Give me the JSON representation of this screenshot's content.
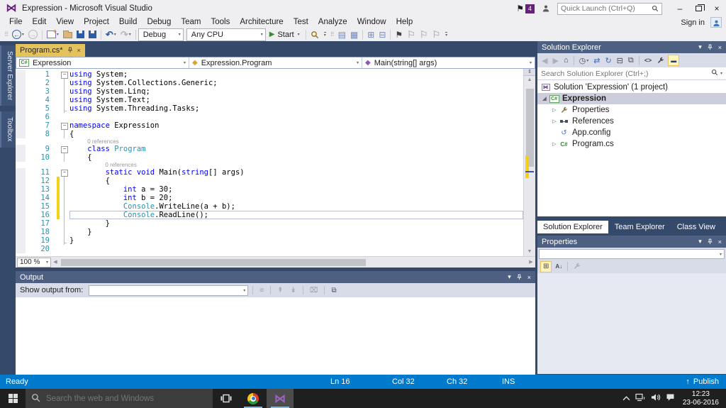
{
  "window": {
    "title": "Expression - Microsoft Visual Studio",
    "notification_count": "4",
    "quick_launch_placeholder": "Quick Launch (Ctrl+Q)",
    "sign_in": "Sign in",
    "minimize": "–",
    "close": "×"
  },
  "menu": {
    "items": [
      "File",
      "Edit",
      "View",
      "Project",
      "Build",
      "Debug",
      "Team",
      "Tools",
      "Architecture",
      "Test",
      "Analyze",
      "Window",
      "Help"
    ]
  },
  "toolbar": {
    "debug_config": "Debug",
    "platform": "Any CPU",
    "start_label": "Start"
  },
  "side_tabs": [
    "Server Explorer",
    "Toolbox"
  ],
  "editor": {
    "tab_title": "Program.cs*",
    "breadcrumbs": {
      "project": "Expression",
      "type": "Expression.Program",
      "member": "Main(string[] args)"
    },
    "zoom": "100 %",
    "codelens_label": "0 references",
    "lines": [
      {
        "n": "1",
        "o": "box",
        "s": [
          [
            "kw",
            "using"
          ],
          [
            "pl",
            " System;"
          ]
        ]
      },
      {
        "n": "2",
        "o": "line",
        "s": [
          [
            "kw",
            "using"
          ],
          [
            "pl",
            " System.Collections.Generic;"
          ]
        ]
      },
      {
        "n": "3",
        "o": "line",
        "s": [
          [
            "kw",
            "using"
          ],
          [
            "pl",
            " System.Linq;"
          ]
        ]
      },
      {
        "n": "4",
        "o": "line",
        "s": [
          [
            "kw",
            "using"
          ],
          [
            "pl",
            " System.Text;"
          ]
        ]
      },
      {
        "n": "5",
        "o": "end",
        "s": [
          [
            "kw",
            "using"
          ],
          [
            "pl",
            " System.Threading.Tasks;"
          ]
        ]
      },
      {
        "n": "6",
        "o": "none",
        "s": []
      },
      {
        "n": "7",
        "o": "box",
        "s": [
          [
            "kw",
            "namespace"
          ],
          [
            "pl",
            " Expression"
          ]
        ]
      },
      {
        "n": "8",
        "o": "line",
        "s": [
          [
            "pl",
            "{"
          ]
        ]
      },
      {
        "cl": true,
        "ind": 4
      },
      {
        "n": "9",
        "o": "box",
        "s": [
          [
            "pl",
            "    "
          ],
          [
            "kw",
            "class"
          ],
          [
            "pl",
            " "
          ],
          [
            "ty",
            "Program"
          ]
        ]
      },
      {
        "n": "10",
        "o": "line",
        "s": [
          [
            "pl",
            "    {"
          ]
        ]
      },
      {
        "cl": true,
        "ind": 8
      },
      {
        "n": "11",
        "o": "box",
        "s": [
          [
            "pl",
            "        "
          ],
          [
            "kw",
            "static"
          ],
          [
            "pl",
            " "
          ],
          [
            "kw",
            "void"
          ],
          [
            "pl",
            " Main("
          ],
          [
            "kw",
            "string"
          ],
          [
            "pl",
            "[] args)"
          ]
        ]
      },
      {
        "n": "12",
        "o": "line",
        "chg": true,
        "s": [
          [
            "pl",
            "        {"
          ]
        ]
      },
      {
        "n": "13",
        "o": "line",
        "chg": true,
        "s": [
          [
            "pl",
            "            "
          ],
          [
            "kw",
            "int"
          ],
          [
            "pl",
            " a = 30;"
          ]
        ]
      },
      {
        "n": "14",
        "o": "line",
        "chg": true,
        "s": [
          [
            "pl",
            "            "
          ],
          [
            "kw",
            "int"
          ],
          [
            "pl",
            " b = 20;"
          ]
        ]
      },
      {
        "n": "15",
        "o": "line",
        "chg": true,
        "s": [
          [
            "pl",
            "            "
          ],
          [
            "ty",
            "Console"
          ],
          [
            "pl",
            ".WriteLine(a + b);"
          ]
        ]
      },
      {
        "n": "16",
        "o": "line",
        "chg": true,
        "cur": true,
        "s": [
          [
            "pl",
            "            "
          ],
          [
            "ty",
            "Console"
          ],
          [
            "pl",
            ".ReadLine();"
          ]
        ]
      },
      {
        "n": "17",
        "o": "line",
        "s": [
          [
            "pl",
            "        }"
          ]
        ]
      },
      {
        "n": "18",
        "o": "line",
        "s": [
          [
            "pl",
            "    }"
          ]
        ]
      },
      {
        "n": "19",
        "o": "end",
        "s": [
          [
            "pl",
            "}"
          ]
        ]
      },
      {
        "n": "20",
        "o": "none",
        "s": []
      }
    ]
  },
  "output": {
    "title": "Output",
    "show_output_from_label": "Show output from:"
  },
  "solution_explorer": {
    "title": "Solution Explorer",
    "search_placeholder": "Search Solution Explorer (Ctrl+;)",
    "tree": [
      {
        "label": "Solution 'Expression' (1 project)",
        "icon": "solution",
        "exp": "hidden",
        "indent": 0
      },
      {
        "label": "Expression",
        "icon": "csharp-project",
        "exp": "expanded",
        "indent": 0,
        "selected": true,
        "bold": true
      },
      {
        "label": "Properties",
        "icon": "wrench",
        "exp": "collapsed",
        "indent": 1
      },
      {
        "label": "References",
        "icon": "references",
        "exp": "collapsed",
        "indent": 1
      },
      {
        "label": "App.config",
        "icon": "config",
        "exp": "blank",
        "indent": 1
      },
      {
        "label": "Program.cs",
        "icon": "csharp-file",
        "exp": "collapsed",
        "indent": 1
      }
    ]
  },
  "panel_tabs": [
    "Solution Explorer",
    "Team Explorer",
    "Class View"
  ],
  "properties": {
    "title": "Properties"
  },
  "status_bar": {
    "state": "Ready",
    "line": "Ln 16",
    "column": "Col 32",
    "character": "Ch 32",
    "mode": "INS",
    "publish": "Publish"
  },
  "taskbar": {
    "search_placeholder": "Search the web and Windows",
    "time": "12:23",
    "date": "23-06-2016"
  },
  "colors": {
    "status_bar": "#007acc",
    "active_doc_tab": "#e5c35c",
    "dock_background": "#35496a",
    "keyword": "#0000ff",
    "type_name": "#2b91af",
    "accent_badge": "#68217a"
  }
}
